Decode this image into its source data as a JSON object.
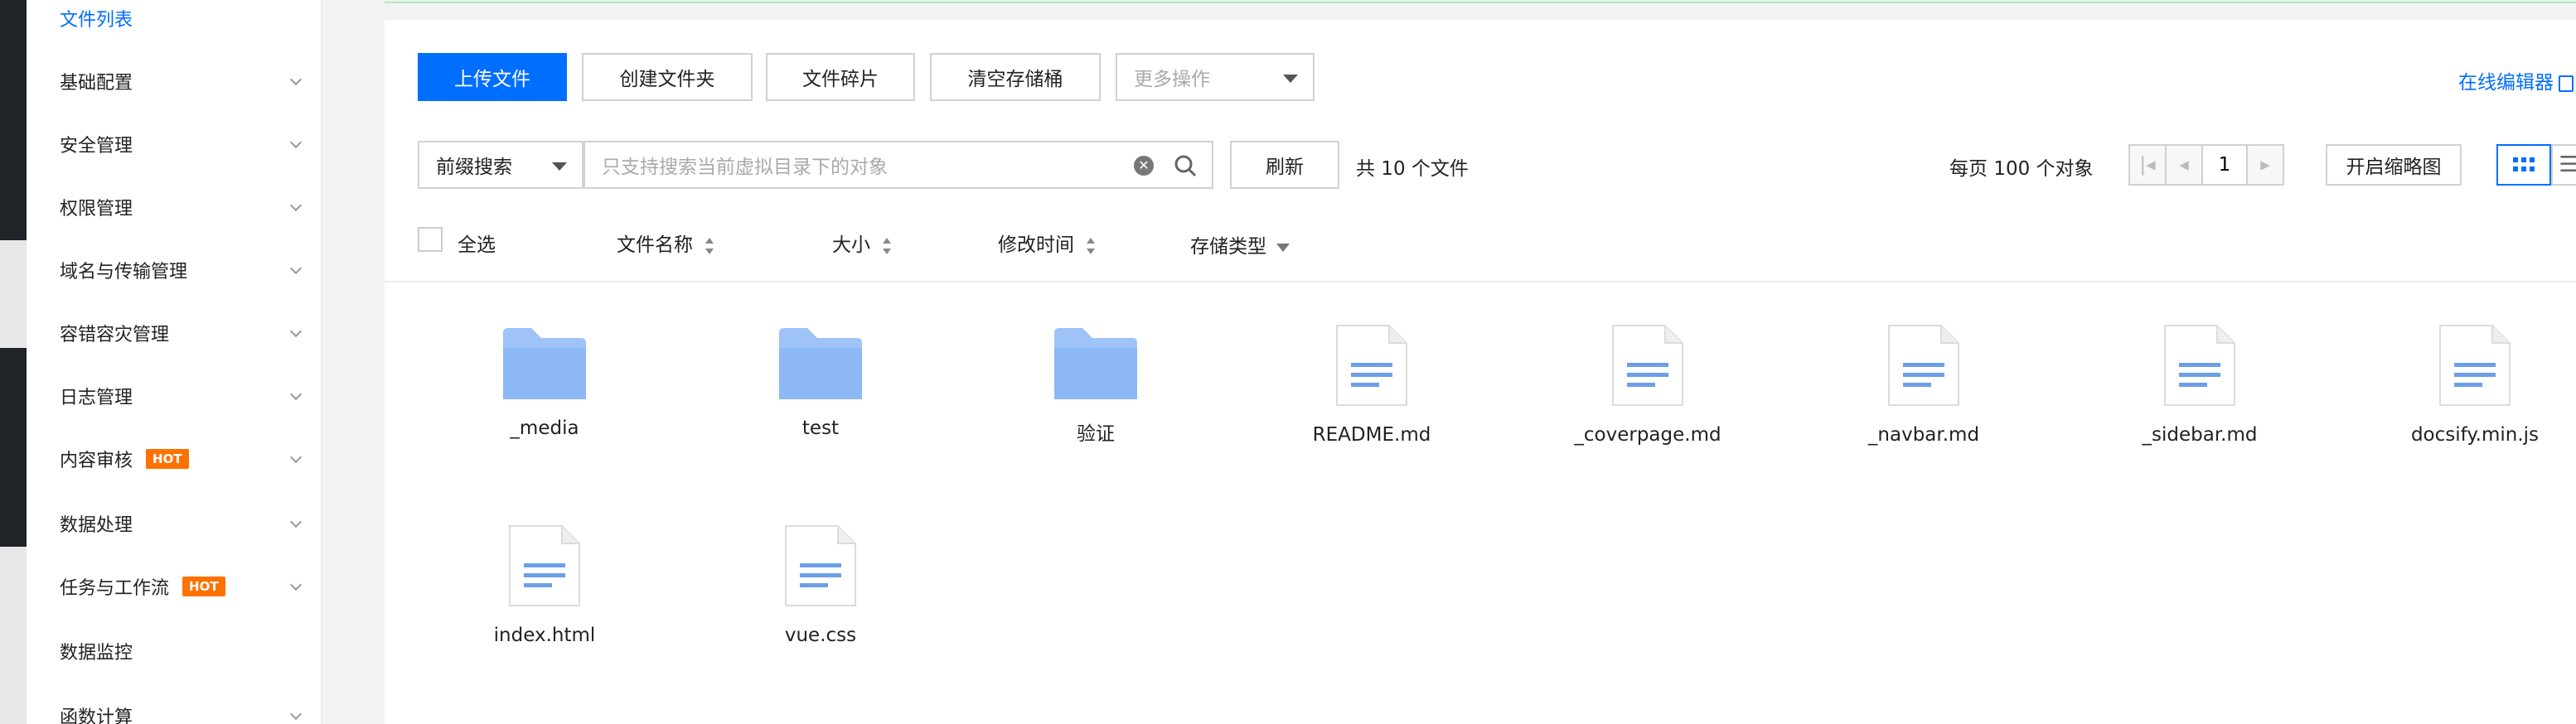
{
  "sidebar": {
    "items": [
      {
        "label": "文件列表",
        "active": true
      },
      {
        "label": "基础配置"
      },
      {
        "label": "安全管理"
      },
      {
        "label": "权限管理"
      },
      {
        "label": "域名与传输管理"
      },
      {
        "label": "容错容灾管理"
      },
      {
        "label": "日志管理"
      },
      {
        "label": "内容审核",
        "badge": "HOT"
      },
      {
        "label": "数据处理"
      },
      {
        "label": "任务与工作流",
        "badge": "HOT"
      },
      {
        "label": "数据监控"
      },
      {
        "label": "函数计算"
      }
    ]
  },
  "toolbar": {
    "upload": "上传文件",
    "create_folder": "创建文件夹",
    "fragments": "文件碎片",
    "clear_bucket": "清空存储桶",
    "more_actions": "更多操作",
    "online_editor": "在线编辑器"
  },
  "search": {
    "mode": "前缀搜索",
    "placeholder": "只支持搜索当前虚拟目录下的对象",
    "refresh": "刷新",
    "total": "共 10 个文件",
    "per_page": "每页 100 个对象",
    "page": "1",
    "thumbnail": "开启缩略图"
  },
  "columns": {
    "select_all": "全选",
    "name": "文件名称",
    "size": "大小",
    "modified": "修改时间",
    "storage_class": "存储类型"
  },
  "files": [
    {
      "name": "_media",
      "type": "folder"
    },
    {
      "name": "test",
      "type": "folder"
    },
    {
      "name": "验证",
      "type": "folder"
    },
    {
      "name": "README.md",
      "type": "file"
    },
    {
      "name": "_coverpage.md",
      "type": "file"
    },
    {
      "name": "_navbar.md",
      "type": "file"
    },
    {
      "name": "_sidebar.md",
      "type": "file"
    },
    {
      "name": "docsify.min.js",
      "type": "file"
    },
    {
      "name": "index.html",
      "type": "file"
    },
    {
      "name": "vue.css",
      "type": "file"
    }
  ],
  "colors": {
    "accent": "#006eff",
    "hot": "#ff7200",
    "folder": "#9dc3f8",
    "doc_lines": "#6b9fe8"
  }
}
